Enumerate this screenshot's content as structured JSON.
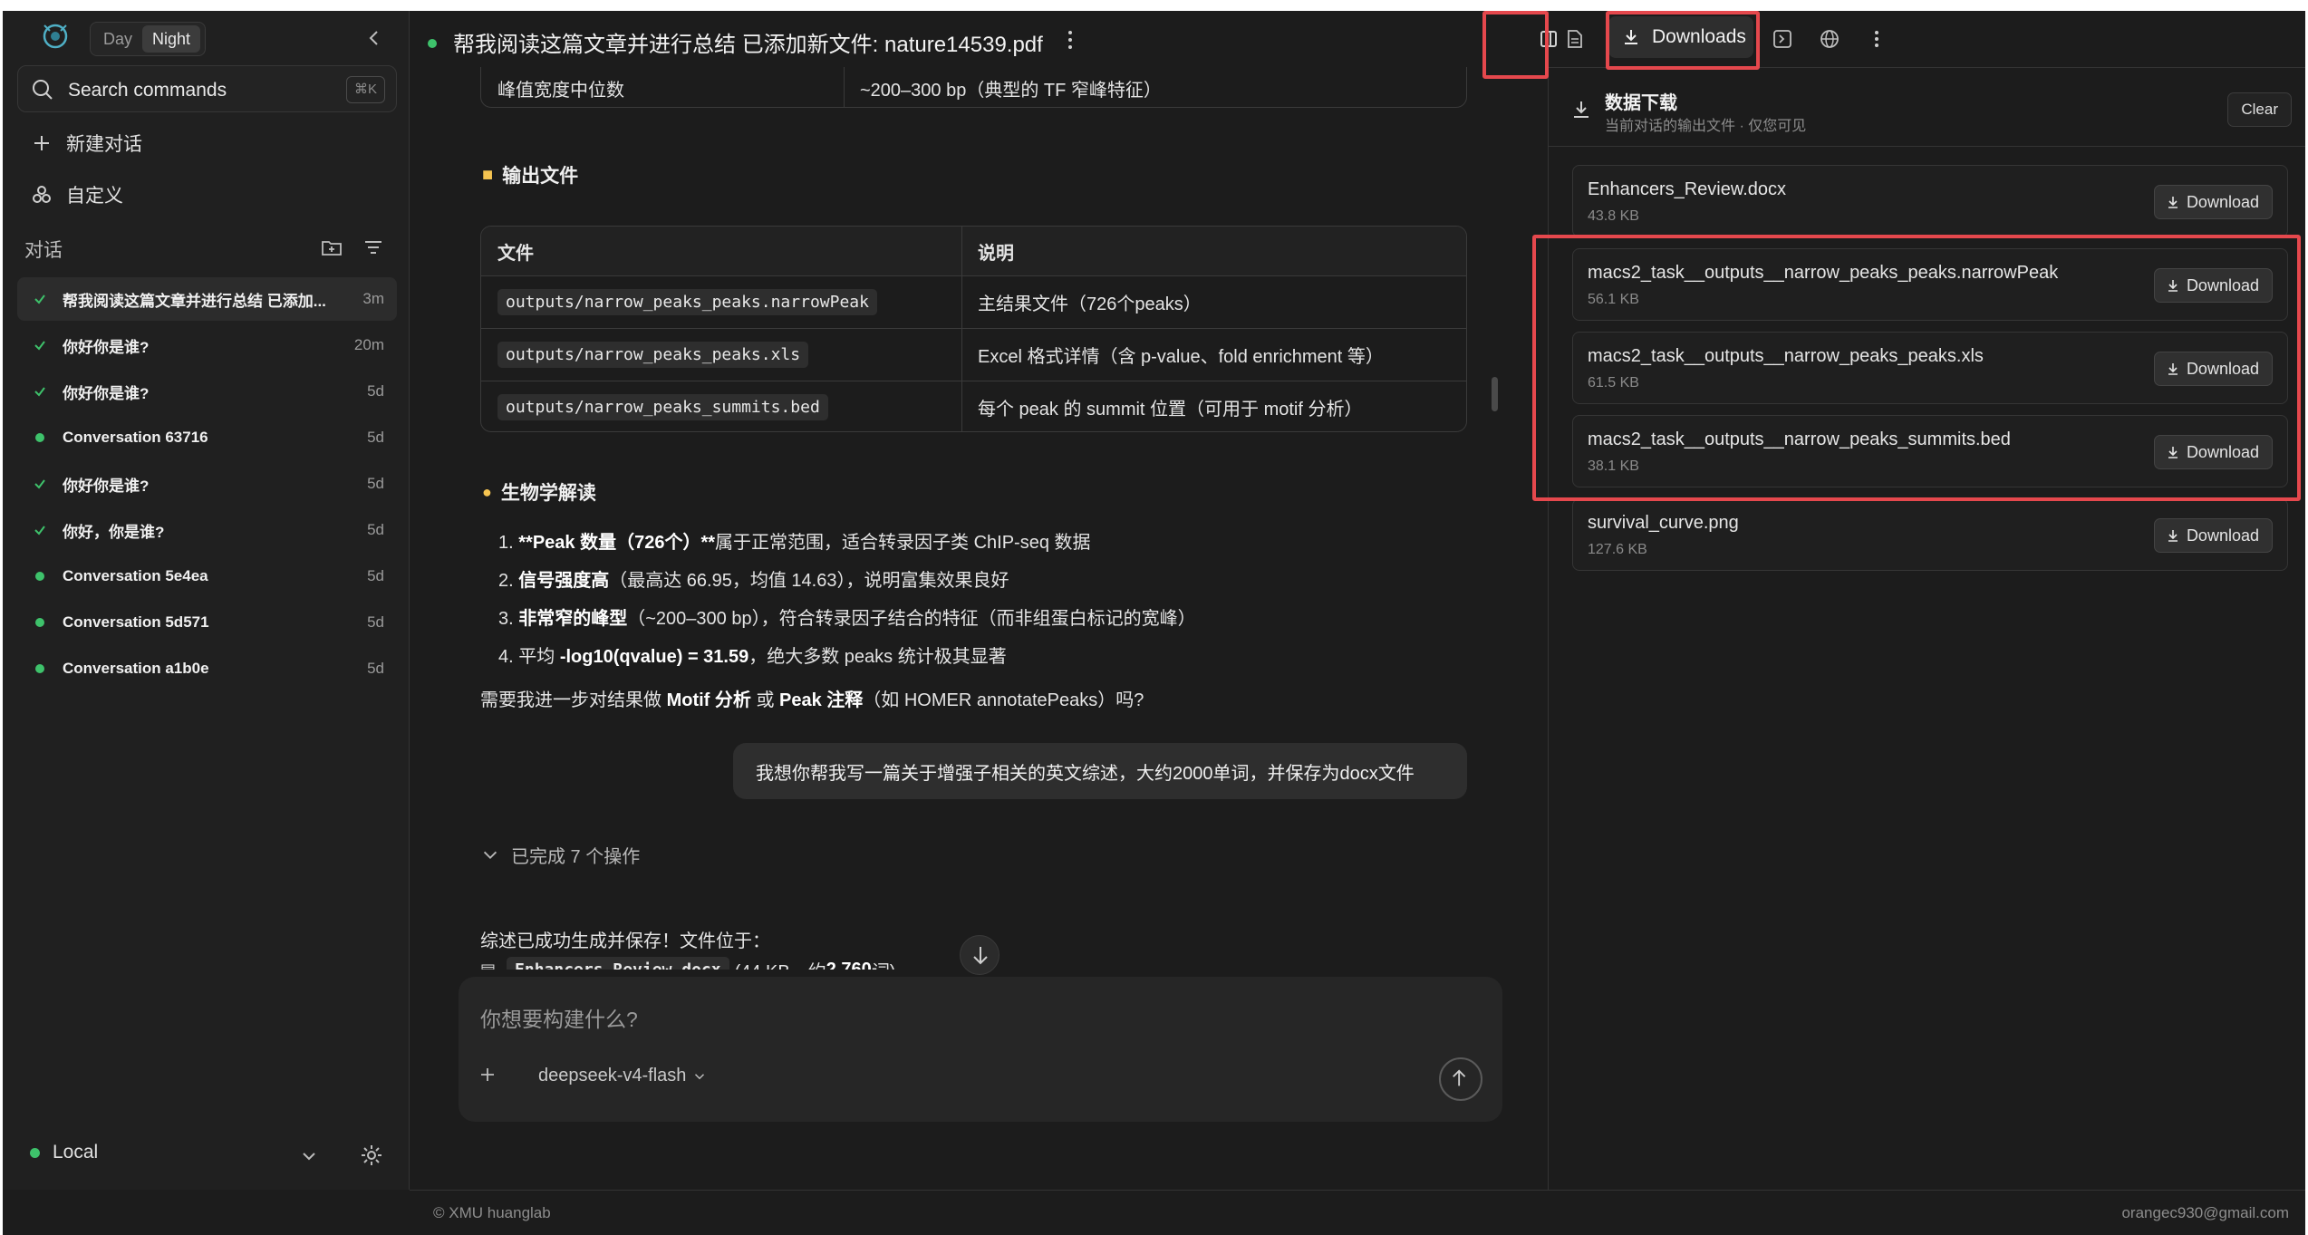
{
  "sidebar": {
    "theme_day": "Day",
    "theme_night": "Night",
    "search_label": "Search commands",
    "search_shortcut": "⌘K",
    "new_chat": "新建对话",
    "customize": "自定义",
    "section_title": "对话",
    "conversations": [
      {
        "title": "帮我阅读这篇文章并进行总结 已添加...",
        "time": "3m",
        "status": "check",
        "active": true
      },
      {
        "title": "你好你是谁?",
        "time": "20m",
        "status": "check"
      },
      {
        "title": "你好你是谁?",
        "time": "5d",
        "status": "check"
      },
      {
        "title": "Conversation 63716",
        "time": "5d",
        "status": "dot"
      },
      {
        "title": "你好你是谁?",
        "time": "5d",
        "status": "check"
      },
      {
        "title": "你好，你是谁?",
        "time": "5d",
        "status": "check"
      },
      {
        "title": "Conversation 5e4ea",
        "time": "5d",
        "status": "dot"
      },
      {
        "title": "Conversation 5d571",
        "time": "5d",
        "status": "dot"
      },
      {
        "title": "Conversation a1b0e",
        "time": "5d",
        "status": "dot"
      }
    ],
    "workspace": "Local"
  },
  "chat": {
    "title": "帮我阅读这篇文章并进行总结 已添加新文件: nature14539.pdf",
    "top_row": {
      "key": "峰值宽度中位数",
      "value": "~200–300 bp（典型的 TF 窄峰特征）"
    },
    "output_heading": "输出文件",
    "table_headers": [
      "文件",
      "说明"
    ],
    "table_rows": [
      {
        "file": "outputs/narrow_peaks_peaks.narrowPeak",
        "desc": "主结果文件（726个peaks）"
      },
      {
        "file": "outputs/narrow_peaks_peaks.xls",
        "desc": "Excel 格式详情（含 p-value、fold enrichment 等）"
      },
      {
        "file": "outputs/narrow_peaks_summits.bed",
        "desc": "每个 peak 的 summit 位置（可用于 motif 分析）"
      }
    ],
    "bio_heading": "生物学解读",
    "list": [
      {
        "num": "1.",
        "bold": "**Peak 数量（726个）**",
        "rest": "属于正常范围，适合转录因子类 ChIP-seq 数据"
      },
      {
        "num": "2.",
        "bold": "信号强度高",
        "rest": "（最高达 66.95，均值 14.63），说明富集效果良好"
      },
      {
        "num": "3.",
        "bold": "非常窄的峰型",
        "rest": "（~200–300 bp），符合转录因子结合的特征（而非组蛋白标记的宽峰）"
      },
      {
        "num": "4.",
        "pre": "平均 ",
        "bold": "-log10(qvalue) = 31.59",
        "rest": "，绝大多数 peaks 统计极其显著"
      }
    ],
    "question_pre": "需要我进一步对结果做 ",
    "question_b1": "Motif 分析",
    "question_mid": "或 ",
    "question_b2": "Peak 注释",
    "question_post": "（如 HOMER annotatePeaks）吗?",
    "user_message": "我想你帮我写一篇关于增强子相关的英文综述，大约2000单词，并保存为docx文件",
    "ops_done": "已完成 7 个操作",
    "saved_text": "综述已成功生成并保存！文件位于：",
    "saved_file": "Enhancers_Review.docx",
    "saved_meta_pre": "(44 KB，约 ",
    "saved_meta_words": "2,760",
    "saved_meta_post": " 词)"
  },
  "composer": {
    "placeholder": "你想要构建什么?",
    "model": "deepseek-v4-flash"
  },
  "panel": {
    "downloads_tab": "Downloads",
    "header_title": "数据下载",
    "header_sub": "当前对话的输出文件 · 仅您可见",
    "clear": "Clear",
    "button_label": "Download",
    "files": [
      {
        "name": "Enhancers_Review.docx",
        "size": "43.8 KB"
      },
      {
        "name": "macs2_task__outputs__narrow_peaks_peaks.narrowPeak",
        "size": "56.1 KB"
      },
      {
        "name": "macs2_task__outputs__narrow_peaks_peaks.xls",
        "size": "61.5 KB"
      },
      {
        "name": "macs2_task__outputs__narrow_peaks_summits.bed",
        "size": "38.1 KB"
      },
      {
        "name": "survival_curve.png",
        "size": "127.6 KB"
      }
    ]
  },
  "footer": {
    "left": "© XMU huanglab",
    "right": "orangec930@gmail.com"
  },
  "colors": {
    "background": "#1c1c1c",
    "sidebar": "#202020",
    "status_green": "#3ec26b",
    "highlight_red": "#e5484d"
  }
}
